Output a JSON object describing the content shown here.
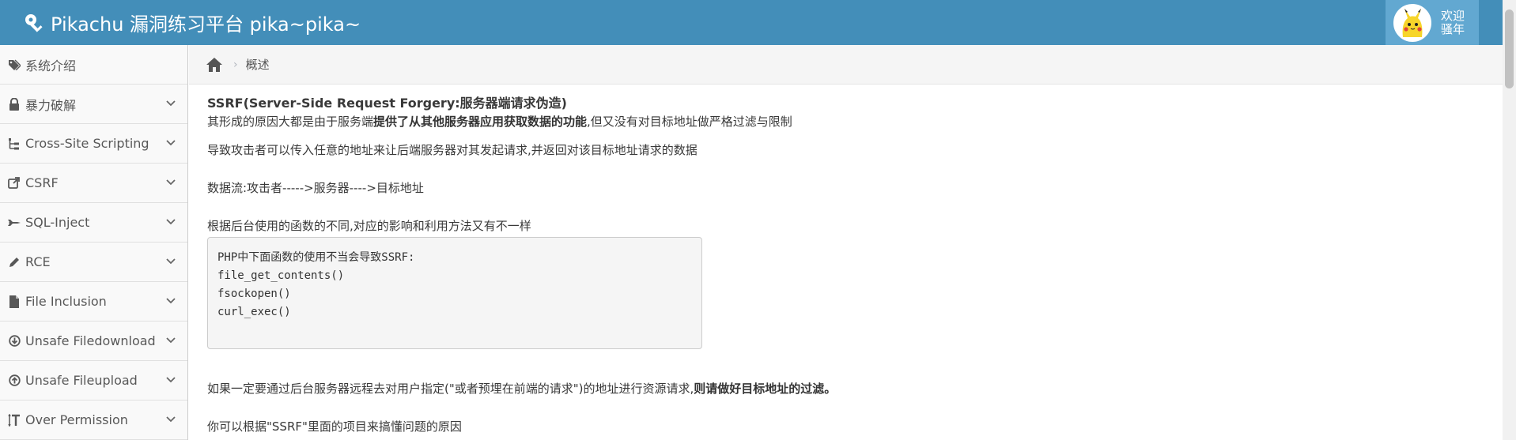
{
  "header": {
    "brand": "Pikachu 漏洞练习平台 pika~pika~",
    "welcome_line1": "欢迎",
    "welcome_line2": "骚年"
  },
  "sidebar": {
    "items": [
      {
        "label": "系统介绍",
        "icon": "tags-icon",
        "has_chevron": false
      },
      {
        "label": "暴力破解",
        "icon": "lock-icon",
        "has_chevron": true
      },
      {
        "label": "Cross-Site Scripting",
        "icon": "sitemap-icon",
        "has_chevron": true
      },
      {
        "label": "CSRF",
        "icon": "share-icon",
        "has_chevron": true
      },
      {
        "label": "SQL-Inject",
        "icon": "fighter-jet-icon",
        "has_chevron": true
      },
      {
        "label": "RCE",
        "icon": "pencil-icon",
        "has_chevron": true
      },
      {
        "label": "File Inclusion",
        "icon": "file-icon",
        "has_chevron": true
      },
      {
        "label": "Unsafe Filedownload",
        "icon": "download-circle-icon",
        "has_chevron": true
      },
      {
        "label": "Unsafe Fileupload",
        "icon": "upload-circle-icon",
        "has_chevron": true
      },
      {
        "label": "Over Permission",
        "icon": "text-height-icon",
        "has_chevron": true
      }
    ]
  },
  "breadcrumb": {
    "current": "概述"
  },
  "content": {
    "title": "SSRF(Server-Side Request Forgery:服务器端请求伪造)",
    "line1_a": "其形成的原因大都是由于服务端",
    "line1_b": "提供了从其他服务器应用获取数据的功能",
    "line1_c": ",但又没有对目标地址做严格过滤与限制",
    "line2": "导致攻击者可以传入任意的地址来让后端服务器对其发起请求,并返回对该目标地址请求的数据",
    "line3": "数据流:攻击者----->服务器---->目标地址",
    "line4": "根据后台使用的函数的不同,对应的影响和利用方法又有不一样",
    "code": [
      "PHP中下面函数的使用不当会导致SSRF:",
      "file_get_contents()",
      "fsockopen()",
      "curl_exec()"
    ],
    "line5_a": "如果一定要通过后台服务器远程去对用户指定(\"或者预埋在前端的请求\")的地址进行资源请求,",
    "line5_b": "则请做好目标地址的过滤。",
    "line6": "你可以根据\"SSRF\"里面的项目来搞懂问题的原因"
  },
  "colors": {
    "navbar": "#438eb9",
    "user_box": "#62a8d1",
    "sidebar_bg": "#f9f9f9"
  }
}
